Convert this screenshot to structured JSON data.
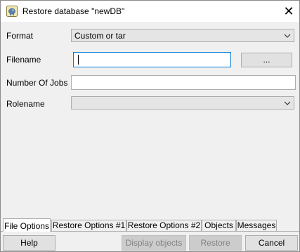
{
  "window": {
    "title": "Restore database \"newDB\"",
    "close_glyph": "✕"
  },
  "form": {
    "format_label": "Format",
    "format_value": "Custom or tar",
    "filename_label": "Filename",
    "filename_value": "",
    "browse_label": "...",
    "jobs_label": "Number Of Jobs",
    "jobs_value": "",
    "rolename_label": "Rolename",
    "rolename_value": ""
  },
  "tabs": [
    {
      "label": "File Options",
      "active": true
    },
    {
      "label": "Restore Options #1",
      "active": false
    },
    {
      "label": "Restore Options #2",
      "active": false
    },
    {
      "label": "Objects",
      "active": false
    },
    {
      "label": "Messages",
      "active": false
    }
  ],
  "buttons": {
    "help": "Help",
    "display_objects": "Display objects",
    "restore": "Restore",
    "cancel": "Cancel"
  },
  "colors": {
    "focus_border": "#0078d7",
    "disabled_text": "#838383"
  }
}
